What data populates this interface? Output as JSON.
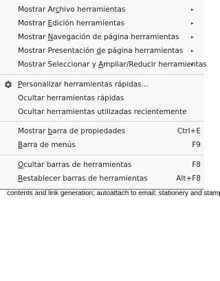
{
  "menu": {
    "toolbars": [
      {
        "pre": "Mostrar Ar",
        "acc": "c",
        "post": "hivo herramientas"
      },
      {
        "pre": "Mostrar ",
        "acc": "E",
        "post": "dición herramientas"
      },
      {
        "pre": "Mostrar ",
        "acc": "N",
        "post": "avegación de página herramientas"
      },
      {
        "pre": "Mostrar Presentación ",
        "acc": "d",
        "post": "e página herramientas"
      },
      {
        "pre": "Mostrar Seleccionar y ",
        "acc": "A",
        "post": "mpliar/Reducir herramientas"
      }
    ],
    "submenu_arrow": "▸",
    "quick_tools": [
      {
        "pre": "",
        "acc": "P",
        "post": "ersonalizar herramientas rápidas...",
        "icon": "gear-icon"
      },
      {
        "pre": "Ocultar herramientas rápidas",
        "acc": "",
        "post": ""
      },
      {
        "pre": "Ocultar herramientas utilizadas recientemente",
        "acc": "",
        "post": ""
      }
    ],
    "bars": [
      {
        "pre": "Mostrar ",
        "acc": "b",
        "post": "arra de propiedades",
        "shortcut": "Ctrl+E"
      },
      {
        "pre": "",
        "acc": "B",
        "post": "arra de menús",
        "shortcut": "F9"
      }
    ],
    "toolbar_actions": [
      {
        "pre": "",
        "acc": "O",
        "post": "cultar barras de herramientas",
        "shortcut": "F8"
      },
      {
        "pre": "",
        "acc": "R",
        "post": "establecer barras de herramientas",
        "shortcut": "Alt+F8"
      }
    ]
  },
  "document": {
    "text": "contents and link generation; autoattach to email; stationery and stamp"
  }
}
